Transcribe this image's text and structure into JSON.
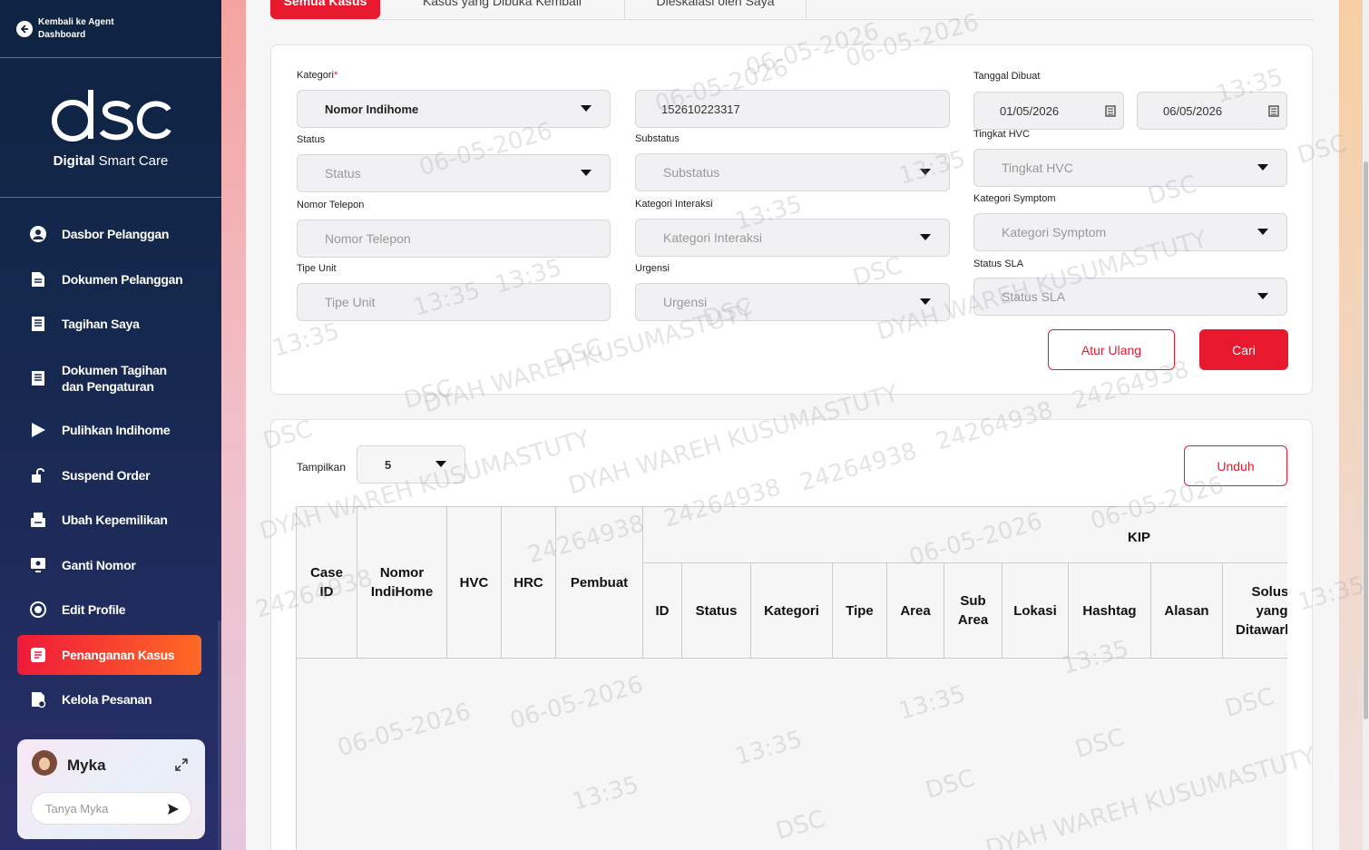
{
  "sidebar": {
    "back_label": "Kembali ke Agent Dashboard",
    "logo_text": "dsc",
    "brand_bold": "Digital",
    "brand_light": " Smart Care",
    "items": [
      {
        "label": "Dasbor Pelanggan",
        "icon": "user-circle-icon"
      },
      {
        "label": "Dokumen Pelanggan",
        "icon": "document-icon"
      },
      {
        "label": "Tagihan Saya",
        "icon": "bill-icon"
      },
      {
        "label": "Dokumen Tagihan dan Pengaturan",
        "icon": "bill-settings-icon"
      },
      {
        "label": "Pulihkan Indihome",
        "icon": "play-icon"
      },
      {
        "label": "Suspend Order",
        "icon": "unlock-icon"
      },
      {
        "label": "Ubah Kepemilikan",
        "icon": "transfer-icon"
      },
      {
        "label": "Ganti Nomor",
        "icon": "phone-screen-icon"
      },
      {
        "label": "Edit Profile",
        "icon": "headset-icon"
      },
      {
        "label": "Penanganan Kasus",
        "icon": "case-icon",
        "active": true
      },
      {
        "label": "Kelola Pesanan",
        "icon": "order-icon"
      }
    ],
    "myka": {
      "name": "Myka",
      "placeholder": "Tanya Myka"
    }
  },
  "tabs": [
    {
      "label": "Semua Kasus",
      "active": true
    },
    {
      "label": "Kasus yang Dibuka Kembali"
    },
    {
      "label": "Dieskalasi oleh Saya"
    }
  ],
  "filter": {
    "kategori_label": "Kategori",
    "kategori_value": "Nomor Indihome",
    "nomor_value": "152610223317",
    "tanggal_label": "Tanggal Dibuat",
    "tanggal_start": "01/05/2026",
    "tanggal_end": "06/05/2026",
    "status_label": "Status",
    "status_placeholder": "Status",
    "substatus_label": "Substatus",
    "substatus_placeholder": "Substatus",
    "hvc_label": "Tingkat HVC",
    "hvc_placeholder": "Tingkat HVC",
    "telepon_label": "Nomor Telepon",
    "telepon_placeholder": "Nomor Telepon",
    "interaksi_label": "Kategori Interaksi",
    "interaksi_placeholder": "Kategori Interaksi",
    "symptom_label": "Kategori Symptom",
    "symptom_placeholder": "Kategori Symptom",
    "tipe_label": "Tipe Unit",
    "tipe_placeholder": "Tipe Unit",
    "urgensi_label": "Urgensi",
    "urgensi_placeholder": "Urgensi",
    "sla_label": "Status SLA",
    "sla_placeholder": "Status SLA",
    "reset_label": "Atur Ulang",
    "search_label": "Cari"
  },
  "results": {
    "show_label": "Tampilkan",
    "show_value": "5",
    "download_label": "Unduh",
    "headers": {
      "case_id": "Case ID",
      "nomor": "Nomor IndiHome",
      "hvc": "HVC",
      "hrc": "HRC",
      "pembuat": "Pembuat",
      "kip": "KIP",
      "kip_cols": [
        "ID",
        "Status",
        "Kategori",
        "Tipe",
        "Area",
        "Sub Area",
        "Lokasi",
        "Hashtag",
        "Alasan",
        "Solusi yang Ditawarkan"
      ]
    }
  },
  "watermark": {
    "date": "06-05-2026",
    "time": "13:35",
    "app": "DSC",
    "user": "DYAH WAREH KUSUMASTUTY",
    "id": "24264938"
  }
}
